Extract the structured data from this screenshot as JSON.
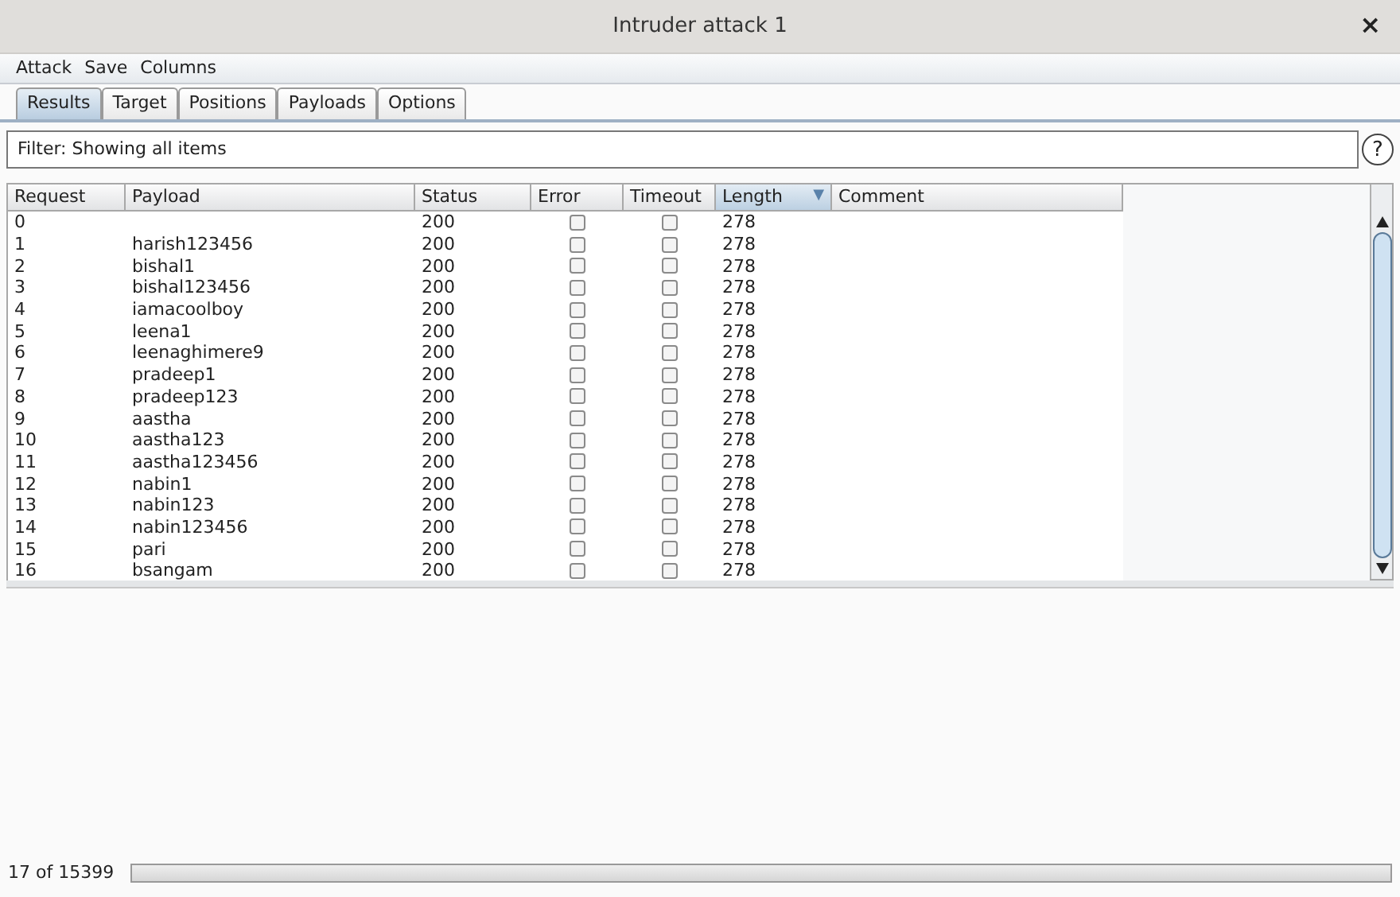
{
  "window": {
    "title": "Intruder attack 1",
    "close": "×"
  },
  "menu": [
    "Attack",
    "Save",
    "Columns"
  ],
  "tabs": [
    {
      "label": "Results",
      "selected": true
    },
    {
      "label": "Target",
      "selected": false
    },
    {
      "label": "Positions",
      "selected": false
    },
    {
      "label": "Payloads",
      "selected": false
    },
    {
      "label": "Options",
      "selected": false
    }
  ],
  "filter": {
    "value": "Filter: Showing all items",
    "help": "?"
  },
  "table": {
    "columns": [
      {
        "label": "Request",
        "sorted": false
      },
      {
        "label": "Payload",
        "sorted": false
      },
      {
        "label": "Status",
        "sorted": false
      },
      {
        "label": "Error",
        "sorted": false
      },
      {
        "label": "Timeout",
        "sorted": false
      },
      {
        "label": "Length",
        "sorted": true,
        "sort_indicator": "▼"
      },
      {
        "label": "Comment",
        "sorted": false
      }
    ],
    "rows": [
      {
        "request": "0",
        "payload": "",
        "status": "200",
        "error": false,
        "timeout": false,
        "length": "278"
      },
      {
        "request": "1",
        "payload": "harish123456",
        "status": "200",
        "error": false,
        "timeout": false,
        "length": "278"
      },
      {
        "request": "2",
        "payload": "bishal1",
        "status": "200",
        "error": false,
        "timeout": false,
        "length": "278"
      },
      {
        "request": "3",
        "payload": "bishal123456",
        "status": "200",
        "error": false,
        "timeout": false,
        "length": "278"
      },
      {
        "request": "4",
        "payload": "iamacoolboy",
        "status": "200",
        "error": false,
        "timeout": false,
        "length": "278"
      },
      {
        "request": "5",
        "payload": "leena1",
        "status": "200",
        "error": false,
        "timeout": false,
        "length": "278"
      },
      {
        "request": "6",
        "payload": "leenaghimere9",
        "status": "200",
        "error": false,
        "timeout": false,
        "length": "278"
      },
      {
        "request": "7",
        "payload": "pradeep1",
        "status": "200",
        "error": false,
        "timeout": false,
        "length": "278"
      },
      {
        "request": "8",
        "payload": "pradeep123",
        "status": "200",
        "error": false,
        "timeout": false,
        "length": "278"
      },
      {
        "request": "9",
        "payload": "aastha",
        "status": "200",
        "error": false,
        "timeout": false,
        "length": "278"
      },
      {
        "request": "10",
        "payload": "aastha123",
        "status": "200",
        "error": false,
        "timeout": false,
        "length": "278"
      },
      {
        "request": "11",
        "payload": "aastha123456",
        "status": "200",
        "error": false,
        "timeout": false,
        "length": "278"
      },
      {
        "request": "12",
        "payload": "nabin1",
        "status": "200",
        "error": false,
        "timeout": false,
        "length": "278"
      },
      {
        "request": "13",
        "payload": "nabin123",
        "status": "200",
        "error": false,
        "timeout": false,
        "length": "278"
      },
      {
        "request": "14",
        "payload": "nabin123456",
        "status": "200",
        "error": false,
        "timeout": false,
        "length": "278"
      },
      {
        "request": "15",
        "payload": "pari",
        "status": "200",
        "error": false,
        "timeout": false,
        "length": "278"
      },
      {
        "request": "16",
        "payload": "bsangam",
        "status": "200",
        "error": false,
        "timeout": false,
        "length": "278"
      }
    ]
  },
  "status_bar": {
    "count": "17 of 15399",
    "progress": {
      "level": 0
    }
  }
}
